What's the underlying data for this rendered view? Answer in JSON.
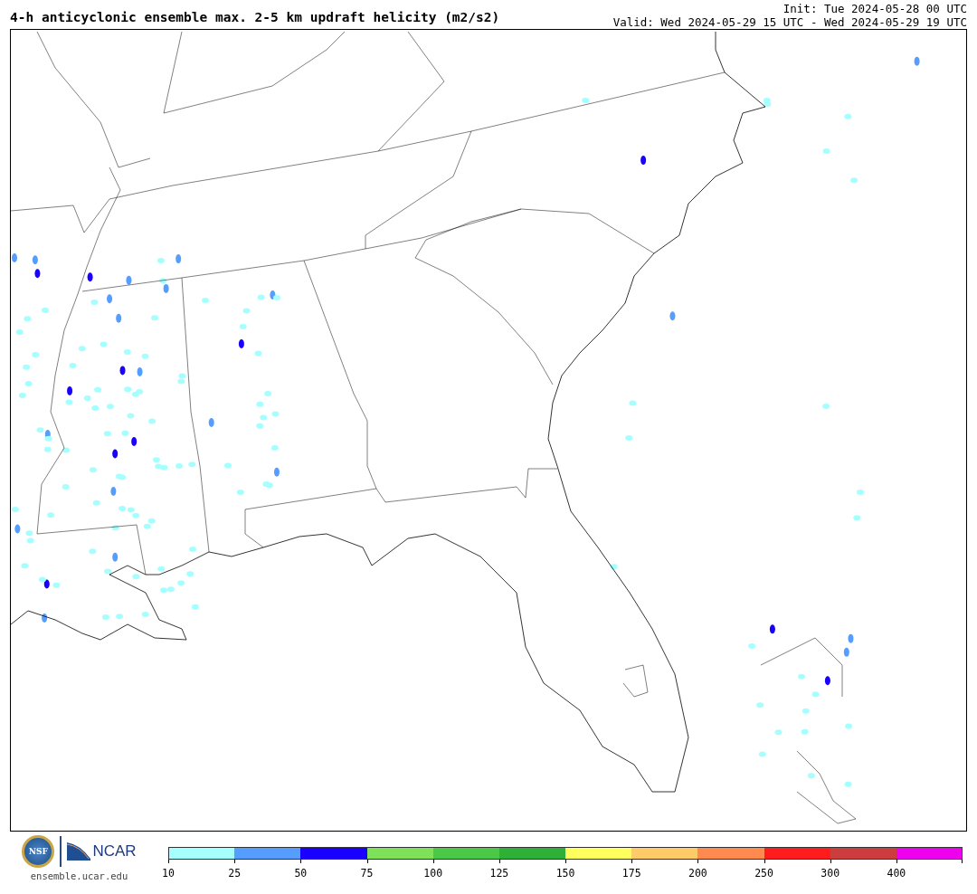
{
  "title": "4-h anticyclonic ensemble max. 2-5 km updraft helicity (m2/s2)",
  "init": "Init: Tue 2024-05-28 00 UTC",
  "valid": "Valid: Wed 2024-05-29 15 UTC - Wed 2024-05-29 19 UTC",
  "logos": {
    "nsf": "NSF",
    "ncar": "NCAR"
  },
  "website": "ensemble.ucar.edu",
  "colorbar": [
    {
      "color": "#a6ffff",
      "label": "10"
    },
    {
      "color": "#559eff",
      "label": "25"
    },
    {
      "color": "#1a00ff",
      "label": "50"
    },
    {
      "color": "#7fe05a",
      "label": "75"
    },
    {
      "color": "#4bc946",
      "label": "100"
    },
    {
      "color": "#2eaf36",
      "label": "125"
    },
    {
      "color": "#ffff5e",
      "label": "150"
    },
    {
      "color": "#ffcb69",
      "label": "175"
    },
    {
      "color": "#ff8a4f",
      "label": "200"
    },
    {
      "color": "#ff1c1c",
      "label": "250"
    },
    {
      "color": "#cc3d3d",
      "label": "300"
    },
    {
      "color": "#ee00ee",
      "label": "400"
    }
  ]
}
